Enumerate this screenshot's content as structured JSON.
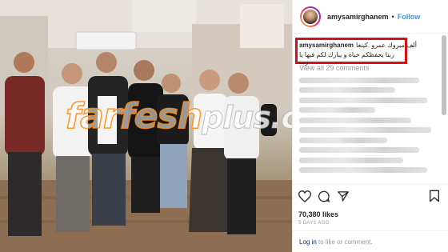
{
  "photo": {
    "watermark": {
      "part1": "farfesh",
      "part2": "plus",
      "part3": ".com"
    }
  },
  "header": {
    "username": "amysamirghanem",
    "separator": "•",
    "follow_label": "Follow"
  },
  "caption": {
    "username": "amysamirghanem",
    "line1": "ألف مبروك عمرو .كينغا",
    "line2": "ربنا يحفظكم حياة و يبارك لكم فيها يا رب"
  },
  "comments": {
    "view_all_label": "View all 29 comments"
  },
  "actions": {
    "likes_label": "70,380 likes",
    "time_ago": "5 DAYS AGO",
    "icons": [
      "heart-icon",
      "comment-icon",
      "share-icon",
      "bookmark-icon"
    ]
  },
  "footer": {
    "login_link": "Log in",
    "login_rest": " to like or comment."
  },
  "colors": {
    "accent_blue": "#3897f0",
    "highlight_red": "#d4111a",
    "muted_text": "#999999"
  }
}
